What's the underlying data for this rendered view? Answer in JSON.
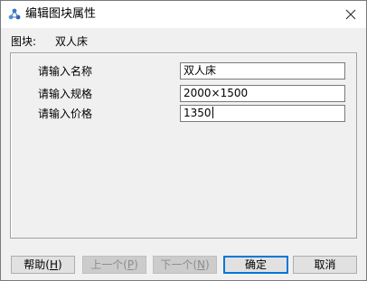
{
  "window": {
    "title": "编辑图块属性",
    "close_label": "×"
  },
  "block": {
    "label": "图块:",
    "value": "双人床"
  },
  "fields": [
    {
      "label": "请输入名称",
      "value": "双人床"
    },
    {
      "label": "请输入规格",
      "value": "2000×1500"
    },
    {
      "label": "请输入价格",
      "value": "1350"
    }
  ],
  "buttons": {
    "help": {
      "text": "帮助(",
      "key": "H",
      "end": ")"
    },
    "prev": {
      "text": "上一个(",
      "key": "P",
      "end": ")"
    },
    "next": {
      "text": "下一个(",
      "key": "N",
      "end": ")"
    },
    "ok": "确定",
    "cancel": "取消"
  },
  "colors": {
    "accent": "#0078d7",
    "disabled_text": "#8d8d8d"
  },
  "icons": {
    "title": "block-attributes-icon",
    "close": "close-icon"
  }
}
